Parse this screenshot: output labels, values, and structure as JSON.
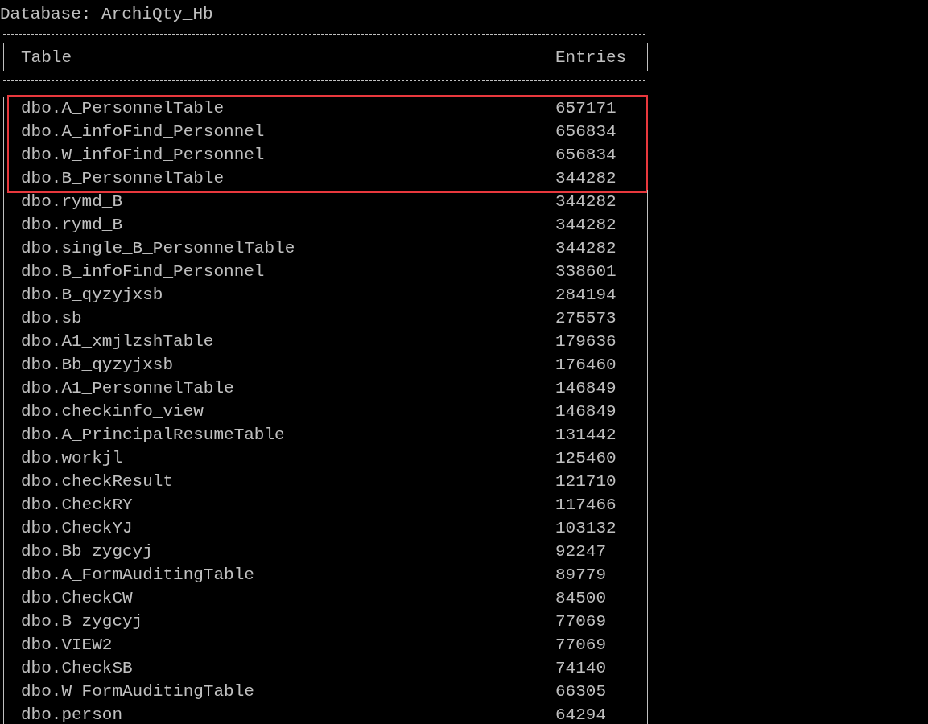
{
  "database_line": "Database: ArchiQty_Hb",
  "table": {
    "columns": [
      "Table",
      "Entries"
    ],
    "rows": [
      {
        "table": "dbo.A_PersonnelTable",
        "entries": "657171",
        "highlighted": true
      },
      {
        "table": "dbo.A_infoFind_Personnel",
        "entries": "656834",
        "highlighted": true
      },
      {
        "table": "dbo.W_infoFind_Personnel",
        "entries": "656834",
        "highlighted": true
      },
      {
        "table": "dbo.B_PersonnelTable",
        "entries": "344282",
        "highlighted": true
      },
      {
        "table": "dbo.rymd_B",
        "entries": "344282",
        "highlighted": false
      },
      {
        "table": "dbo.rymd_B",
        "entries": "344282",
        "highlighted": false
      },
      {
        "table": "dbo.single_B_PersonnelTable",
        "entries": "344282",
        "highlighted": false
      },
      {
        "table": "dbo.B_infoFind_Personnel",
        "entries": "338601",
        "highlighted": false
      },
      {
        "table": "dbo.B_qyzyjxsb",
        "entries": "284194",
        "highlighted": false
      },
      {
        "table": "dbo.sb",
        "entries": "275573",
        "highlighted": false
      },
      {
        "table": "dbo.A1_xmjlzshTable",
        "entries": "179636",
        "highlighted": false
      },
      {
        "table": "dbo.Bb_qyzyjxsb",
        "entries": "176460",
        "highlighted": false
      },
      {
        "table": "dbo.A1_PersonnelTable",
        "entries": "146849",
        "highlighted": false
      },
      {
        "table": "dbo.checkinfo_view",
        "entries": "146849",
        "highlighted": false
      },
      {
        "table": "dbo.A_PrincipalResumeTable",
        "entries": "131442",
        "highlighted": false
      },
      {
        "table": "dbo.workjl",
        "entries": "125460",
        "highlighted": false
      },
      {
        "table": "dbo.checkResult",
        "entries": "121710",
        "highlighted": false
      },
      {
        "table": "dbo.CheckRY",
        "entries": "117466",
        "highlighted": false
      },
      {
        "table": "dbo.CheckYJ",
        "entries": "103132",
        "highlighted": false
      },
      {
        "table": "dbo.Bb_zygcyj",
        "entries": "92247",
        "highlighted": false
      },
      {
        "table": "dbo.A_FormAuditingTable",
        "entries": "89779",
        "highlighted": false
      },
      {
        "table": "dbo.CheckCW",
        "entries": "84500",
        "highlighted": false
      },
      {
        "table": "dbo.B_zygcyj",
        "entries": "77069",
        "highlighted": false
      },
      {
        "table": "dbo.VIEW2",
        "entries": "77069",
        "highlighted": false
      },
      {
        "table": "dbo.CheckSB",
        "entries": "74140",
        "highlighted": false
      },
      {
        "table": "dbo.W_FormAuditingTable",
        "entries": "66305",
        "highlighted": false
      },
      {
        "table": "dbo.person",
        "entries": "64294",
        "highlighted": false
      }
    ]
  }
}
